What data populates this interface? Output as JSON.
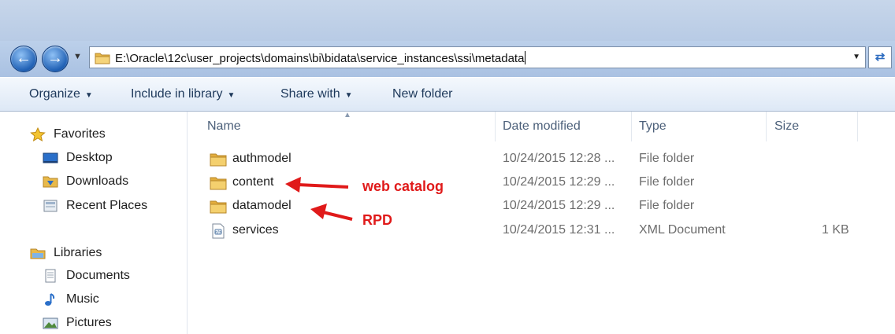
{
  "address_bar": {
    "path": "E:\\Oracle\\12c\\user_projects\\domains\\bi\\bidata\\service_instances\\ssi\\metadata"
  },
  "toolbar": {
    "organize": "Organize",
    "include_in_library": "Include in library",
    "share_with": "Share with",
    "new_folder": "New folder"
  },
  "sidebar": {
    "favorites": {
      "label": "Favorites",
      "items": [
        {
          "label": "Desktop",
          "icon": "desktop-icon"
        },
        {
          "label": "Downloads",
          "icon": "downloads-folder-icon"
        },
        {
          "label": "Recent Places",
          "icon": "recent-places-icon"
        }
      ]
    },
    "libraries": {
      "label": "Libraries",
      "items": [
        {
          "label": "Documents",
          "icon": "document-icon"
        },
        {
          "label": "Music",
          "icon": "music-icon"
        },
        {
          "label": "Pictures",
          "icon": "pictures-icon"
        }
      ]
    }
  },
  "columns": {
    "name": "Name",
    "date_modified": "Date modified",
    "type": "Type",
    "size": "Size"
  },
  "files": [
    {
      "name": "authmodel",
      "date_modified": "10/24/2015 12:28 ...",
      "type": "File folder",
      "size": "",
      "icon": "folder-icon"
    },
    {
      "name": "content",
      "date_modified": "10/24/2015 12:29 ...",
      "type": "File folder",
      "size": "",
      "icon": "folder-icon"
    },
    {
      "name": "datamodel",
      "date_modified": "10/24/2015 12:29 ...",
      "type": "File folder",
      "size": "",
      "icon": "folder-icon"
    },
    {
      "name": "services",
      "date_modified": "10/24/2015 12:31 ...",
      "type": "XML Document",
      "size": "1 KB",
      "icon": "xml-file-icon"
    }
  ],
  "annotations": {
    "content": "web catalog",
    "datamodel": "RPD"
  },
  "colors": {
    "annotation": "#e01a1a",
    "toolbar_text": "#1e395b",
    "header_text": "#4c607a"
  }
}
